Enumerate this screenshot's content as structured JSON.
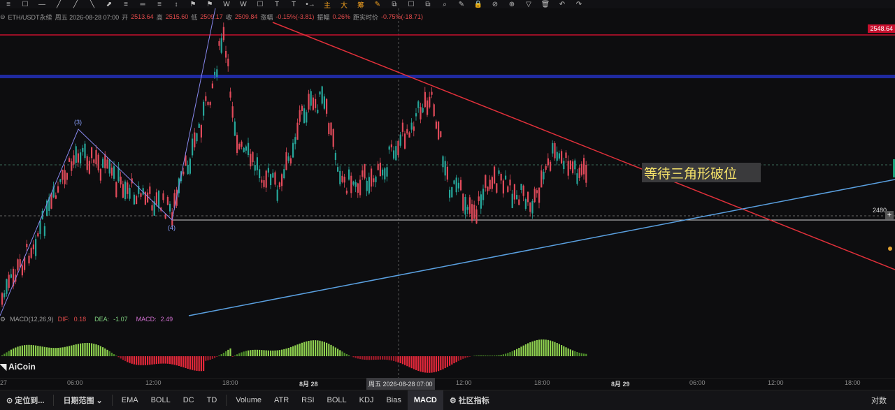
{
  "toolbar": {
    "tools": [
      "≡",
      "☐",
      "—",
      "╱",
      "╱",
      "╲",
      "⬈",
      "≡",
      "═",
      "≡",
      "↕",
      "⚑",
      "⚑",
      "W",
      "W",
      "☐",
      "T",
      "T",
      "•→",
      "主",
      "大",
      "筹",
      "✎",
      "⧉",
      "☐",
      "⧉",
      "⌕",
      "✎",
      "🔒",
      "⊘",
      "⊕",
      "▽",
      "🗑",
      "↶",
      "↷"
    ],
    "accent_indices": [
      19,
      20,
      21,
      22
    ]
  },
  "info": {
    "symbol": "ETH/USDT永续",
    "date": "周五 2026-08-28 07:00",
    "open_label": "开",
    "open": "2513.64",
    "high_label": "高",
    "high": "2515.60",
    "low_label": "低",
    "low": "2509.17",
    "close_label": "收",
    "close": "2509.84",
    "change_label": "涨幅",
    "change": "-0.15%(-3.81)",
    "amp_label": "振幅",
    "amp": "0.26%",
    "realtime_label": "距实时价",
    "realtime": "-0.75%(-18.71)"
  },
  "price_tags": {
    "resistance": "2548.64",
    "current": "2480"
  },
  "annotation": "等待三角形破位",
  "wave_labels": {
    "w3": "(3)",
    "w4": "(4)"
  },
  "macd": {
    "name": "MACD(12,26,9)",
    "dif_label": "DIF:",
    "dif": "0.18",
    "dea_label": "DEA:",
    "dea": "-1.07",
    "macd_label": "MACD:",
    "macd": "2.49"
  },
  "logo": "AiCoin",
  "xaxis": {
    "ticks": [
      {
        "label": "27",
        "bold": false
      },
      {
        "label": "06:00",
        "bold": false
      },
      {
        "label": "12:00",
        "bold": false
      },
      {
        "label": "18:00",
        "bold": false
      },
      {
        "label": "8月 28",
        "bold": true
      },
      {
        "label": "12:00",
        "bold": false
      },
      {
        "label": "18:00",
        "bold": false
      },
      {
        "label": "8月 29",
        "bold": true
      },
      {
        "label": "06:00",
        "bold": false
      },
      {
        "label": "12:00",
        "bold": false
      },
      {
        "label": "18:00",
        "bold": false
      }
    ],
    "crosshair": "周五 2026-08-28 07:00"
  },
  "bottombar": {
    "locate": "定位到...",
    "range": "日期范围",
    "indicators": [
      "EMA",
      "BOLL",
      "DC",
      "TD"
    ],
    "sub_indicators": [
      "Volume",
      "ATR",
      "RSI",
      "BOLL",
      "KDJ",
      "Bias",
      "MACD"
    ],
    "active": "MACD",
    "community": "社区指标",
    "compare": "对数"
  }
}
